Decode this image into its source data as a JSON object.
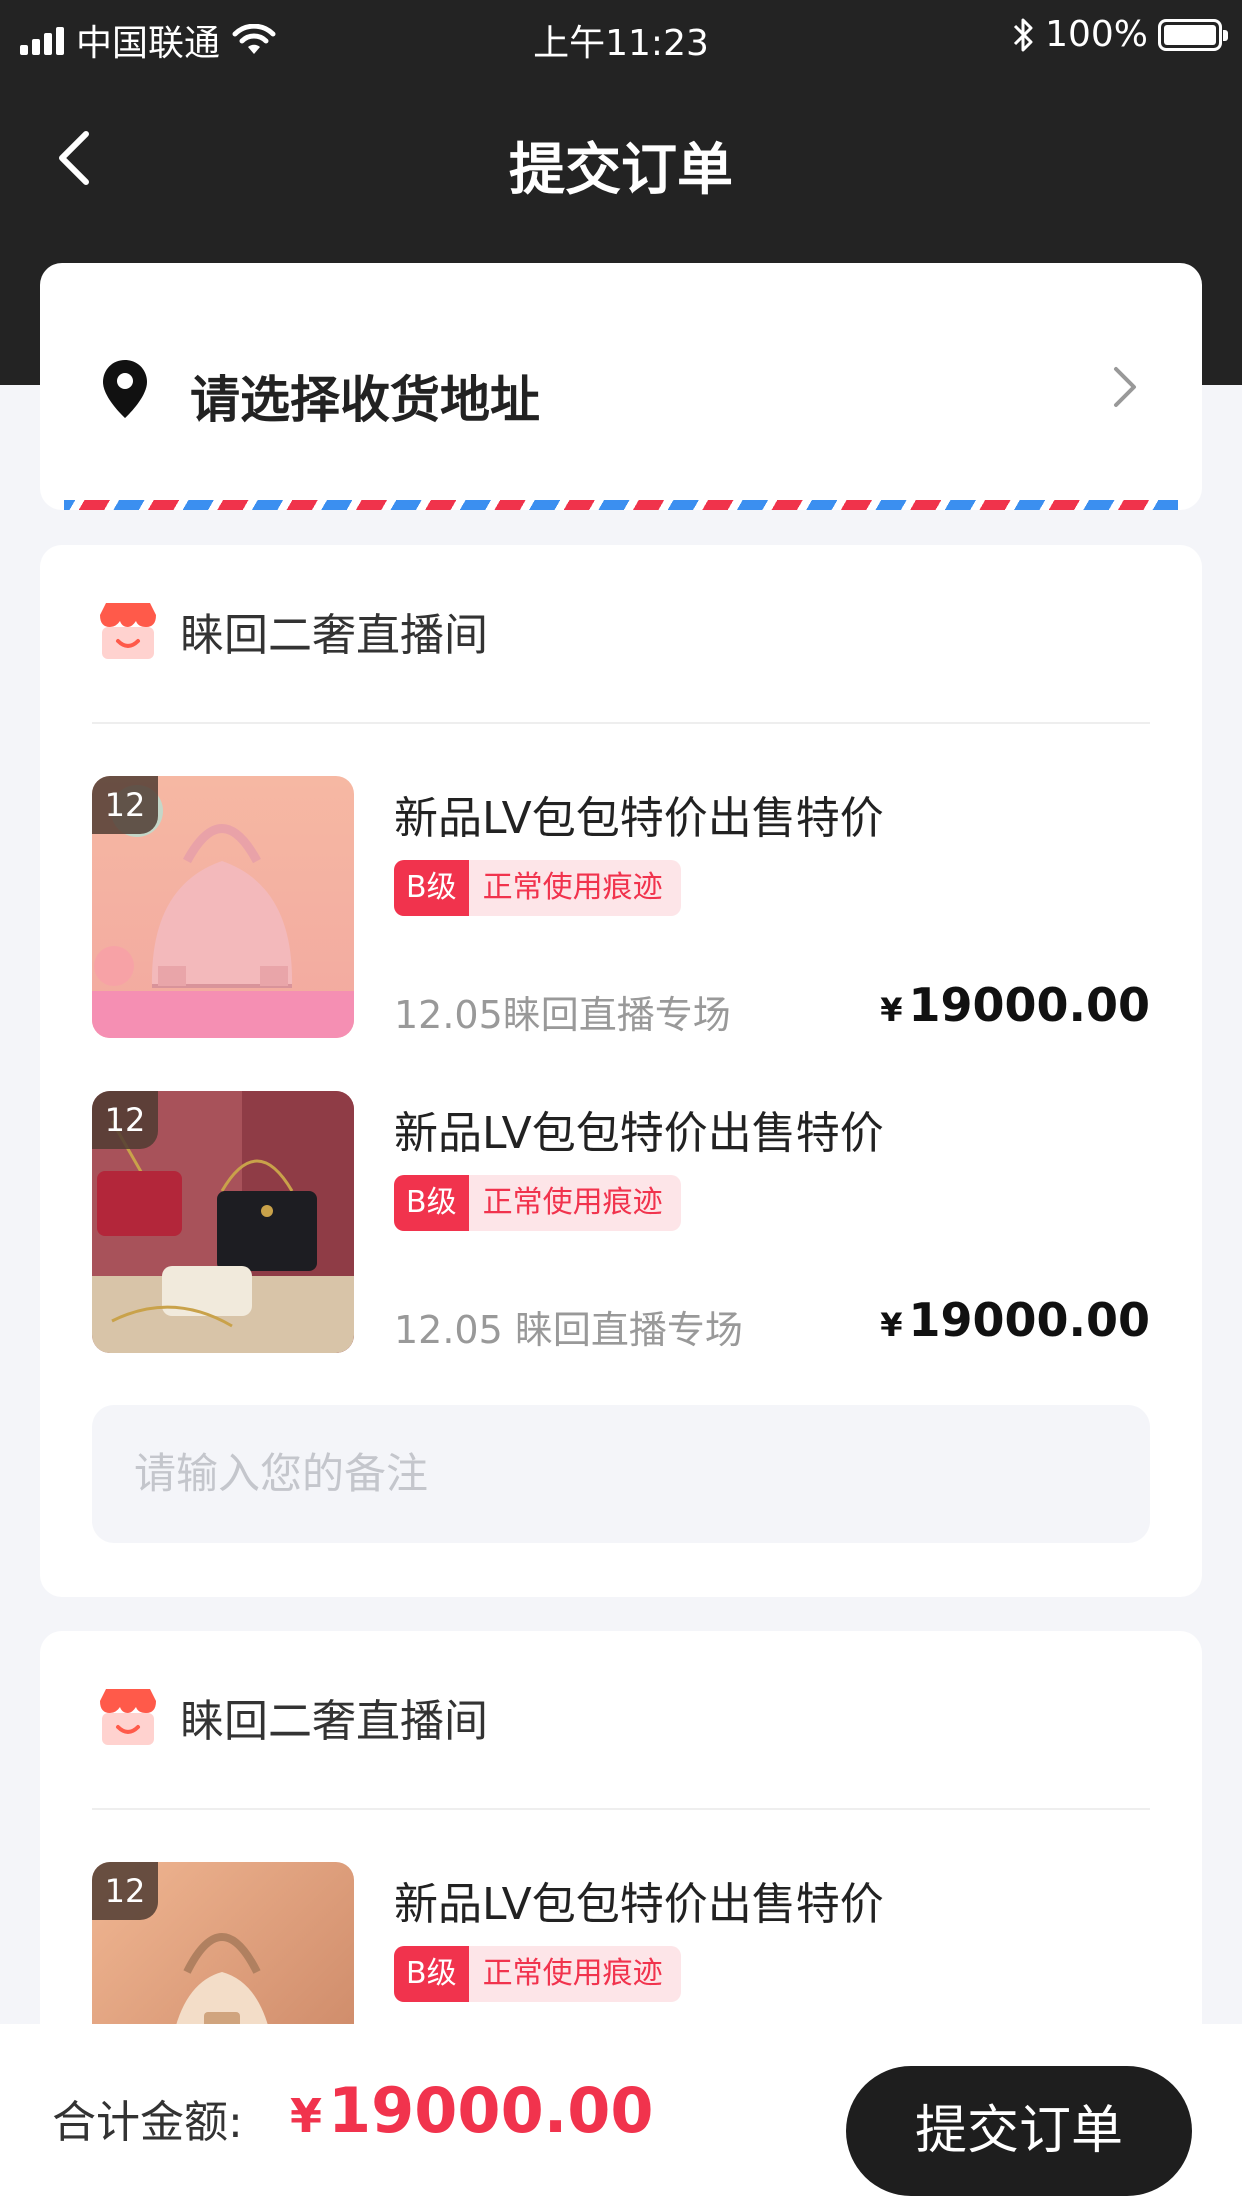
{
  "status_bar": {
    "carrier": "中国联通",
    "time": "上午11:23",
    "battery": "100%"
  },
  "nav": {
    "title": "提交订单"
  },
  "address": {
    "placeholder": "请选择收货地址"
  },
  "shops": [
    {
      "name": "睐回二奢直播间",
      "items": [
        {
          "badge": "12",
          "title": "新品LV包包特价出售特价",
          "grade": "B级",
          "condition": "正常使用痕迹",
          "session": "12.05睐回直播专场",
          "currency": "¥",
          "price": "19000.00"
        },
        {
          "badge": "12",
          "title": "新品LV包包特价出售特价",
          "grade": "B级",
          "condition": "正常使用痕迹",
          "session": "12.05 睐回直播专场",
          "currency": "¥",
          "price": "19000.00"
        }
      ],
      "remark_placeholder": "请输入您的备注"
    },
    {
      "name": "睐回二奢直播间",
      "items": [
        {
          "badge": "12",
          "title": "新品LV包包特价出售特价",
          "grade": "B级",
          "condition": "正常使用痕迹"
        }
      ]
    }
  ],
  "footer": {
    "total_label": "合计金额:",
    "currency": "¥",
    "total_value": "19000.00",
    "submit_label": "提交订单"
  },
  "colors": {
    "accent_red": "#f1334d",
    "header_dark": "#232323",
    "page_bg": "#f4f5f9",
    "airmail_blue": "#3b8ff0"
  },
  "icons": {
    "location": "location-pin-icon",
    "shop": "shop-icon",
    "back": "chevron-left-icon",
    "arrow": "chevron-right-icon"
  }
}
